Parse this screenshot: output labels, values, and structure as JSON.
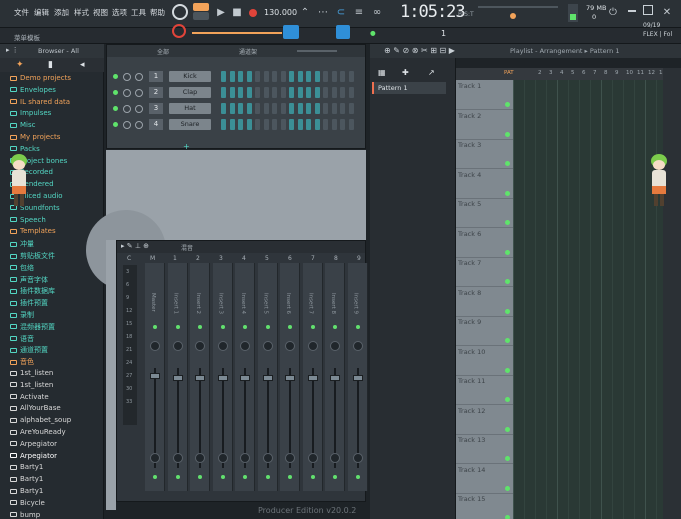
{
  "menu": [
    "文件",
    "编辑",
    "添加",
    "样式",
    "视图",
    "选项",
    "工具",
    "帮助"
  ],
  "transport": {
    "tempo": "130.000",
    "pattern_label": "Pattern 1",
    "song_label": "PAT"
  },
  "time": {
    "value": "1:05:23",
    "sub": "B:S:T"
  },
  "hint": "菜单模板",
  "cpu": {
    "memory": "79 MB",
    "polyphony": "0"
  },
  "version_info": {
    "date": "09/19",
    "label": "FLEX | Fol"
  },
  "browser": {
    "title": "Browser - All",
    "items": [
      {
        "label": "Demo projects",
        "color": "#f2a35a"
      },
      {
        "label": "Envelopes",
        "color": "#53d7c4"
      },
      {
        "label": "IL shared data",
        "color": "#f2a35a"
      },
      {
        "label": "Impulses",
        "color": "#53d7c4"
      },
      {
        "label": "Misc",
        "color": "#53d7c4"
      },
      {
        "label": "My projects",
        "color": "#f2a35a"
      },
      {
        "label": "Packs",
        "color": "#53d7c4"
      },
      {
        "label": "Project bones",
        "color": "#53d7c4"
      },
      {
        "label": "Recorded",
        "color": "#53d7c4"
      },
      {
        "label": "Rendered",
        "color": "#53d7c4"
      },
      {
        "label": "Sliced audio",
        "color": "#53d7c4"
      },
      {
        "label": "Soundfonts",
        "color": "#53d7c4"
      },
      {
        "label": "Speech",
        "color": "#53d7c4"
      },
      {
        "label": "Templates",
        "color": "#f2a35a"
      },
      {
        "label": "冲量",
        "color": "#53d7c4"
      },
      {
        "label": "剪贴板文件",
        "color": "#53d7c4"
      },
      {
        "label": "包络",
        "color": "#53d7c4"
      },
      {
        "label": "声音字体",
        "color": "#53d7c4"
      },
      {
        "label": "插件数据库",
        "color": "#53d7c4"
      },
      {
        "label": "插件预置",
        "color": "#53d7c4"
      },
      {
        "label": "录制",
        "color": "#53d7c4"
      },
      {
        "label": "混频器预置",
        "color": "#53d7c4"
      },
      {
        "label": "语音",
        "color": "#53d7c4"
      },
      {
        "label": "通道预置",
        "color": "#53d7c4"
      },
      {
        "label": "音色",
        "color": "#f2a35a"
      },
      {
        "label": "1st_listen",
        "color": "#d9d9d9"
      },
      {
        "label": "1st_listen",
        "color": "#d9d9d9"
      },
      {
        "label": "Activate",
        "color": "#d9d9d9"
      },
      {
        "label": "AllYourBase",
        "color": "#d9d9d9"
      },
      {
        "label": "alphabet_soup",
        "color": "#d9d9d9"
      },
      {
        "label": "AreYouReady",
        "color": "#d9d9d9"
      },
      {
        "label": "Arpegiator",
        "color": "#d9d9d9"
      },
      {
        "label": "Arpegiator",
        "color": "#ffffff"
      },
      {
        "label": "Barty1",
        "color": "#d9d9d9"
      },
      {
        "label": "Barty1",
        "color": "#d9d9d9"
      },
      {
        "label": "Barty1",
        "color": "#d9d9d9"
      },
      {
        "label": "Bicycle",
        "color": "#d9d9d9"
      },
      {
        "label": "bump",
        "color": "#d9d9d9"
      }
    ]
  },
  "channel_rack": {
    "title": "全部",
    "subtitle": "通道架",
    "channels": [
      {
        "num": "1",
        "name": "Kick"
      },
      {
        "num": "2",
        "name": "Clap"
      },
      {
        "num": "3",
        "name": "Hat"
      },
      {
        "num": "4",
        "name": "Snare"
      }
    ]
  },
  "mixer": {
    "title": "混音",
    "columns": [
      "C",
      "M",
      "1",
      "2",
      "3",
      "4",
      "5",
      "6",
      "7",
      "8",
      "9"
    ],
    "strips": [
      "Master",
      "Insert 1",
      "Insert 2",
      "Insert 3",
      "Insert 4",
      "Insert 5",
      "Insert 6",
      "Insert 7",
      "Insert 8",
      "Insert 9"
    ],
    "meter_ticks": [
      "3",
      "6",
      "9",
      "12",
      "15",
      "18",
      "21",
      "24",
      "27",
      "30",
      "33"
    ]
  },
  "edition": "Producer Edition v20.0.2",
  "playlist": {
    "title": "Playlist - Arrangement",
    "pattern": "Pattern 1",
    "tracks": [
      "Track 1",
      "Track 2",
      "Track 3",
      "Track 4",
      "Track 5",
      "Track 6",
      "Track 7",
      "Track 8",
      "Track 9",
      "Track 10",
      "Track 11",
      "Track 12",
      "Track 13",
      "Track 14",
      "Track 15"
    ],
    "bars": [
      "2",
      "3",
      "4",
      "5",
      "6",
      "7",
      "8",
      "9",
      "10",
      "11",
      "12",
      "13"
    ]
  },
  "colors": {
    "accent_orange": "#f2a35a",
    "accent_teal": "#53d7c4",
    "led_green": "#5fe36b",
    "record_red": "#e0443a"
  }
}
